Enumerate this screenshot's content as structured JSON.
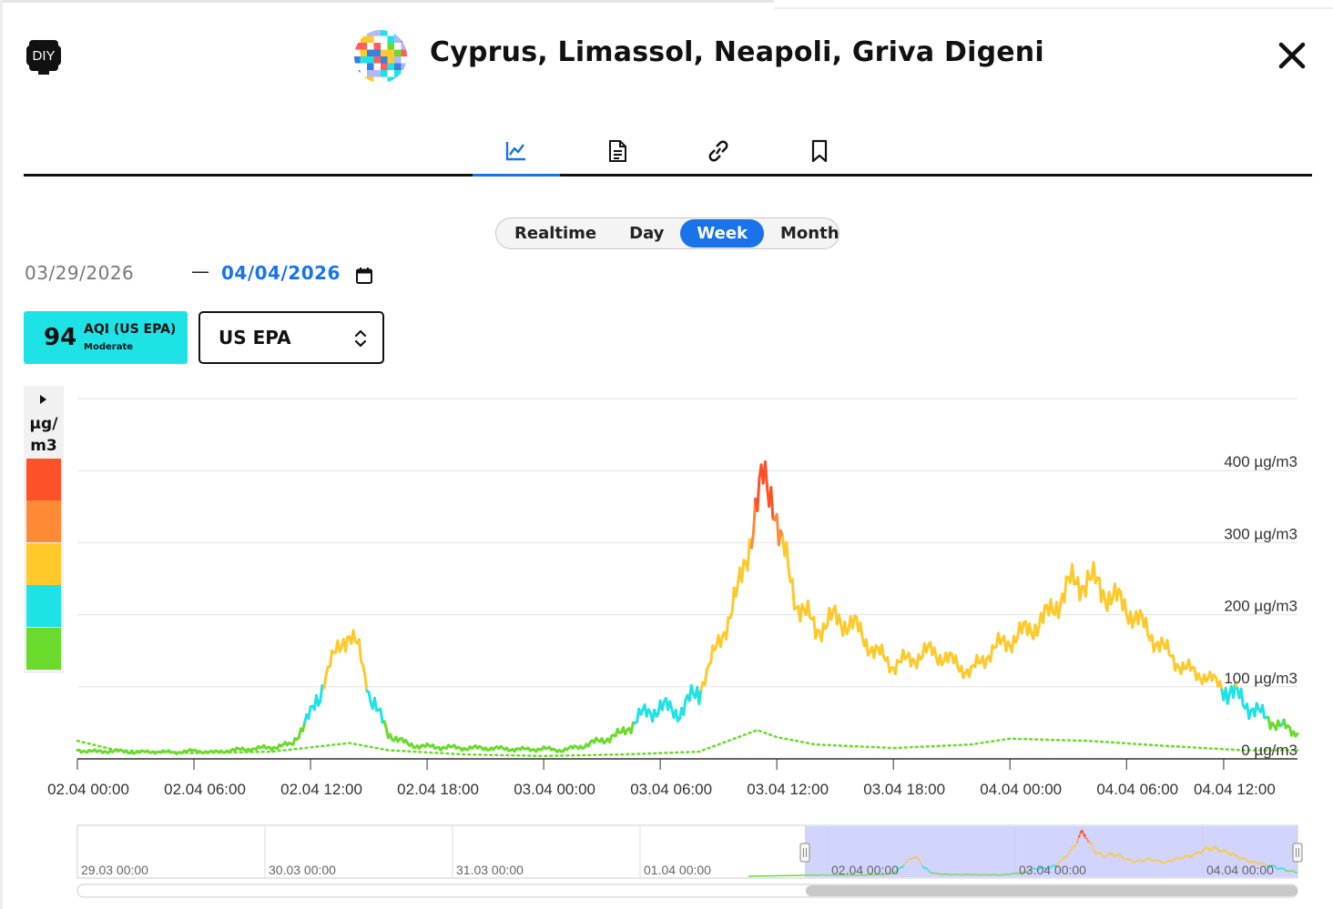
{
  "header": {
    "diy_badge": "DIY",
    "station_title": "Cyprus, Limassol, Neapoli, Griva Digeni",
    "close_icon": "close-icon"
  },
  "tabs": [
    {
      "name": "chart",
      "icon": "line-chart-icon",
      "active": true
    },
    {
      "name": "document",
      "icon": "document-icon",
      "active": false
    },
    {
      "name": "link",
      "icon": "link-icon",
      "active": false
    },
    {
      "name": "bookmark",
      "icon": "bookmark-icon",
      "active": false
    }
  ],
  "period": {
    "options": [
      "Realtime",
      "Day",
      "Week",
      "Month"
    ],
    "selected": "Week"
  },
  "date_range": {
    "from": "03/29/2026",
    "to": "04/04/2026",
    "separator": "—"
  },
  "aqi": {
    "value": "94",
    "label": "AQI (US EPA)",
    "category": "Moderate",
    "color": "#1ee3e6"
  },
  "standard_select": {
    "value": "US EPA"
  },
  "legend": {
    "unit_line1": "µg/",
    "unit_line2": "m3",
    "colors": [
      "#ff5128",
      "#ff8a36",
      "#ffc92a",
      "#1ee3e6",
      "#6adb2c"
    ]
  },
  "colors": {
    "accent": "#1a73e8",
    "good": "#6adb2c",
    "moderate": "#1ee3e6",
    "usg": "#ffc92a",
    "unhealthy": "#ff8a36",
    "very_unhealthy": "#ff5128",
    "navigator_fill": "#c9cdfb"
  },
  "chart_data": {
    "type": "line",
    "y_unit": "µg/m3",
    "ylim": [
      0,
      500
    ],
    "y_ticks": [
      {
        "value": 0,
        "label": "0 µg/m3"
      },
      {
        "value": 100,
        "label": "100 µg/m3"
      },
      {
        "value": 200,
        "label": "200 µg/m3"
      },
      {
        "value": 300,
        "label": "300 µg/m3"
      },
      {
        "value": 400,
        "label": "400 µg/m3"
      }
    ],
    "x_start": "02.04 00:00",
    "x_end": "04.04 14:30",
    "x_ticks": [
      {
        "hour": 0,
        "label": "02.04 00:00"
      },
      {
        "hour": 6,
        "label": "02.04 06:00"
      },
      {
        "hour": 12,
        "label": "02.04 12:00"
      },
      {
        "hour": 18,
        "label": "02.04 18:00"
      },
      {
        "hour": 24,
        "label": "03.04 00:00"
      },
      {
        "hour": 30,
        "label": "03.04 06:00"
      },
      {
        "hour": 36,
        "label": "03.04 12:00"
      },
      {
        "hour": 42,
        "label": "03.04 18:00"
      },
      {
        "hour": 48,
        "label": "04.04 00:00"
      },
      {
        "hour": 54,
        "label": "04.04 06:00"
      },
      {
        "hour": 59,
        "label": "04.04 12:00"
      }
    ],
    "grid": true,
    "series": [
      {
        "style": "solid",
        "points": [
          [
            0,
            12
          ],
          [
            1,
            10
          ],
          [
            2,
            11
          ],
          [
            3,
            9
          ],
          [
            4,
            10
          ],
          [
            5,
            9
          ],
          [
            6,
            11
          ],
          [
            7,
            9
          ],
          [
            8,
            12
          ],
          [
            9,
            14
          ],
          [
            10,
            16
          ],
          [
            11,
            20
          ],
          [
            12,
            60
          ],
          [
            13,
            130
          ],
          [
            13.7,
            168
          ],
          [
            14,
            172
          ],
          [
            14.5,
            150
          ],
          [
            15,
            95
          ],
          [
            15.5,
            62
          ],
          [
            16,
            35
          ],
          [
            17,
            20
          ],
          [
            18,
            17
          ],
          [
            19,
            16
          ],
          [
            20,
            15
          ],
          [
            21,
            15
          ],
          [
            22,
            14
          ],
          [
            23,
            13
          ],
          [
            24,
            14
          ],
          [
            25,
            12
          ],
          [
            26,
            18
          ],
          [
            27,
            26
          ],
          [
            28,
            35
          ],
          [
            29,
            60
          ],
          [
            30,
            72
          ],
          [
            31,
            65
          ],
          [
            32,
            95
          ],
          [
            33,
            160
          ],
          [
            34,
            230
          ],
          [
            34.8,
            330
          ],
          [
            35.3,
            385
          ],
          [
            35.8,
            370
          ],
          [
            36.2,
            300
          ],
          [
            37,
            220
          ],
          [
            38,
            180
          ],
          [
            39,
            195
          ],
          [
            40,
            185
          ],
          [
            41,
            150
          ],
          [
            42,
            130
          ],
          [
            43,
            140
          ],
          [
            44,
            150
          ],
          [
            45,
            135
          ],
          [
            46,
            120
          ],
          [
            47,
            150
          ],
          [
            48,
            165
          ],
          [
            49,
            180
          ],
          [
            50,
            200
          ],
          [
            51,
            240
          ],
          [
            52,
            250
          ],
          [
            53,
            230
          ],
          [
            54,
            210
          ],
          [
            55,
            180
          ],
          [
            56,
            150
          ],
          [
            57,
            125
          ],
          [
            58,
            115
          ],
          [
            59,
            100
          ],
          [
            60,
            80
          ],
          [
            61,
            60
          ],
          [
            62,
            45
          ],
          [
            62.8,
            35
          ]
        ]
      },
      {
        "style": "dotted",
        "points": [
          [
            0,
            25
          ],
          [
            2,
            12
          ],
          [
            6,
            8
          ],
          [
            10,
            10
          ],
          [
            14,
            22
          ],
          [
            16,
            12
          ],
          [
            20,
            6
          ],
          [
            24,
            4
          ],
          [
            28,
            6
          ],
          [
            32,
            10
          ],
          [
            35,
            40
          ],
          [
            36,
            30
          ],
          [
            38,
            20
          ],
          [
            42,
            15
          ],
          [
            46,
            20
          ],
          [
            48,
            28
          ],
          [
            52,
            25
          ],
          [
            56,
            18
          ],
          [
            60,
            12
          ],
          [
            62.8,
            12
          ]
        ]
      }
    ]
  },
  "navigator": {
    "labels": [
      "29.03 00:00",
      "30.03 00:00",
      "31.03 00:00",
      "01.04 00:00",
      "02.04 00:00",
      "03.04 00:00",
      "04.04 00:00"
    ]
  }
}
